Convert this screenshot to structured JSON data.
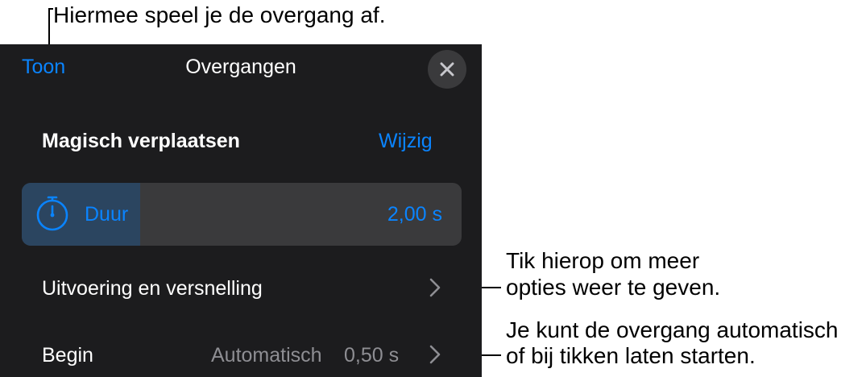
{
  "callouts": {
    "play": "Hiermee speel je de overgang af.",
    "more_line1": "Tik hierop om meer",
    "more_line2": "opties weer te geven.",
    "start_line1": "Je kunt de overgang automatisch",
    "start_line2": "of bij tikken laten starten."
  },
  "header": {
    "play_label": "Toon",
    "title": "Overgangen",
    "close_icon": "close-icon"
  },
  "transition": {
    "name": "Magisch verplaatsen",
    "change_label": "Wijzig"
  },
  "duration": {
    "label": "Duur",
    "value": "2,00 s",
    "fill_fraction": 0.27,
    "icon": "stopwatch-icon"
  },
  "rows": {
    "execution_label": "Uitvoering en versnelling",
    "start_label": "Begin",
    "start_mode": "Automatisch",
    "start_delay": "0,50 s"
  },
  "colors": {
    "accent": "#0a84ff",
    "panel_bg": "#1c1c1e",
    "control_bg": "#3a3a3c",
    "fill_bg": "#2b4560",
    "secondary_text": "#8e8e93"
  }
}
